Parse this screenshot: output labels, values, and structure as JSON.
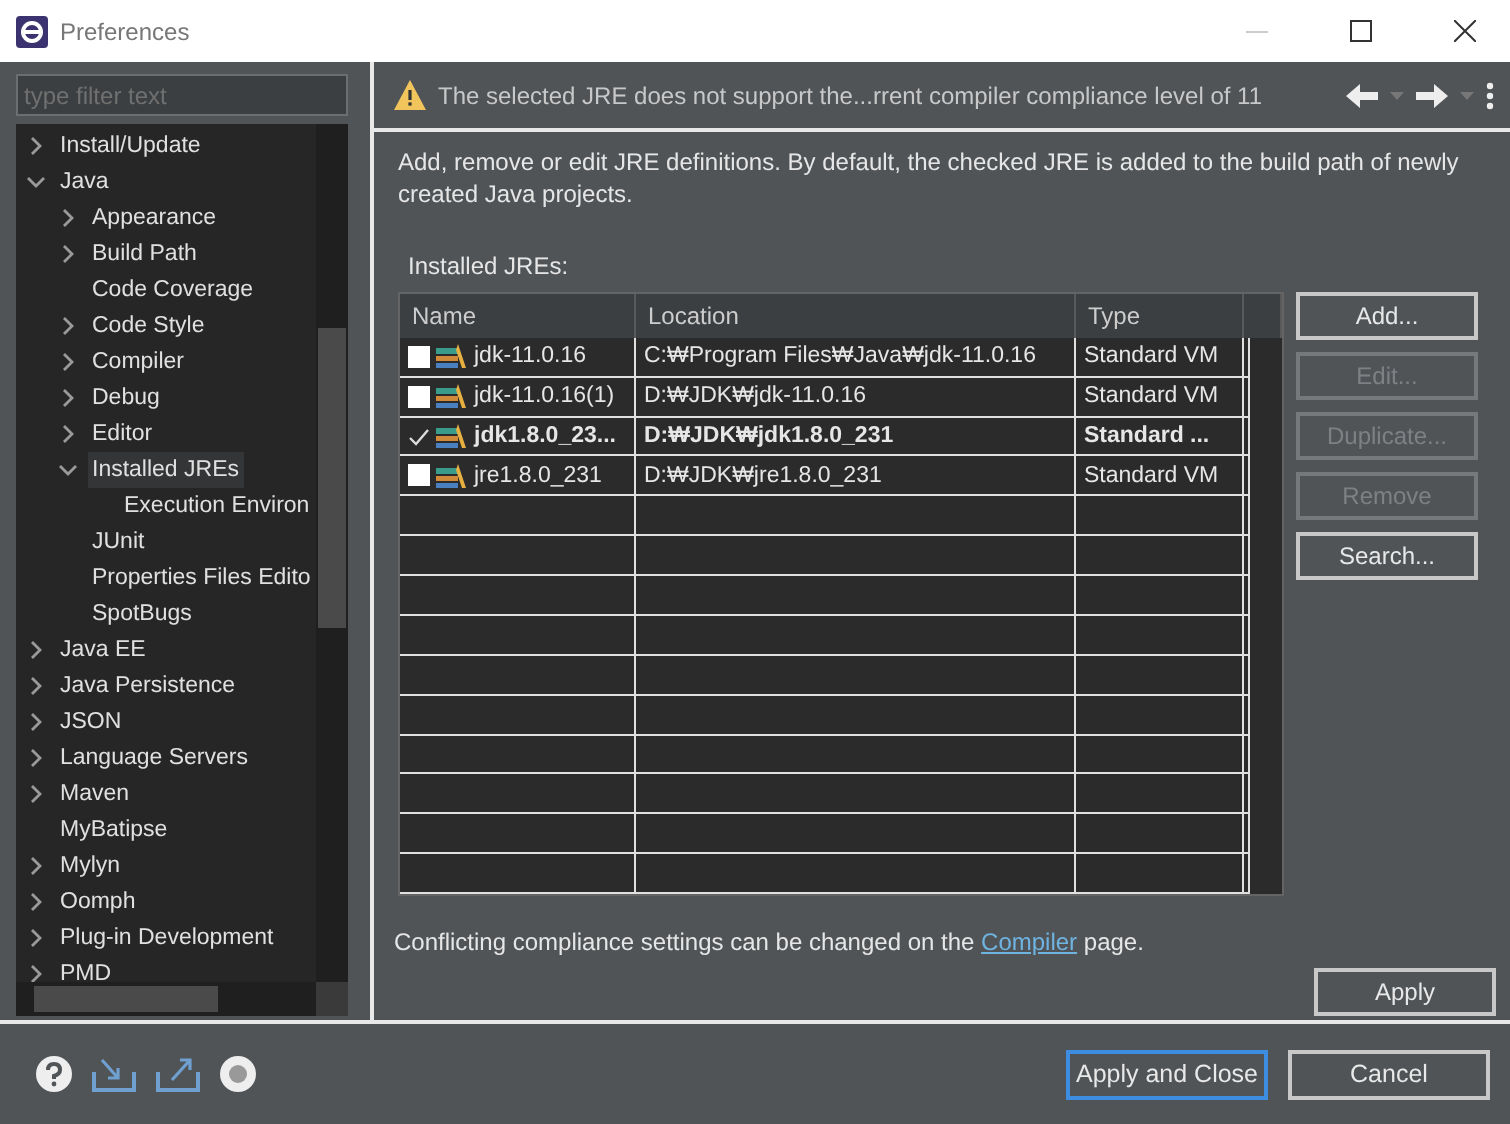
{
  "window": {
    "title": "Preferences"
  },
  "filter": {
    "placeholder": "type filter text"
  },
  "tree": [
    {
      "label": "Install/Update",
      "kind": "branch",
      "expanded": false,
      "selected": false
    },
    {
      "label": "Java",
      "kind": "branch",
      "expanded": true,
      "selected": false,
      "children": [
        {
          "label": "Appearance",
          "kind": "branch",
          "expanded": false,
          "selected": false
        },
        {
          "label": "Build Path",
          "kind": "branch",
          "expanded": false,
          "selected": false
        },
        {
          "label": "Code Coverage",
          "kind": "leaf",
          "selected": false
        },
        {
          "label": "Code Style",
          "kind": "branch",
          "expanded": false,
          "selected": false
        },
        {
          "label": "Compiler",
          "kind": "branch",
          "expanded": false,
          "selected": false
        },
        {
          "label": "Debug",
          "kind": "branch",
          "expanded": false,
          "selected": false
        },
        {
          "label": "Editor",
          "kind": "branch",
          "expanded": false,
          "selected": false
        },
        {
          "label": "Installed JREs",
          "kind": "branch",
          "expanded": true,
          "selected": true,
          "children": [
            {
              "label": "Execution Environ",
              "kind": "leaf",
              "selected": false
            }
          ]
        },
        {
          "label": "JUnit",
          "kind": "leaf",
          "selected": false
        },
        {
          "label": "Properties Files Edito",
          "kind": "leaf",
          "selected": false
        },
        {
          "label": "SpotBugs",
          "kind": "leaf",
          "selected": false
        }
      ]
    },
    {
      "label": "Java EE",
      "kind": "branch",
      "expanded": false,
      "selected": false
    },
    {
      "label": "Java Persistence",
      "kind": "branch",
      "expanded": false,
      "selected": false
    },
    {
      "label": "JSON",
      "kind": "branch",
      "expanded": false,
      "selected": false
    },
    {
      "label": "Language Servers",
      "kind": "branch",
      "expanded": false,
      "selected": false
    },
    {
      "label": "Maven",
      "kind": "branch",
      "expanded": false,
      "selected": false
    },
    {
      "label": "MyBatipse",
      "kind": "leaf",
      "selected": false
    },
    {
      "label": "Mylyn",
      "kind": "branch",
      "expanded": false,
      "selected": false
    },
    {
      "label": "Oomph",
      "kind": "branch",
      "expanded": false,
      "selected": false
    },
    {
      "label": "Plug-in Development",
      "kind": "branch",
      "expanded": false,
      "selected": false
    },
    {
      "label": "PMD",
      "kind": "branch",
      "expanded": false,
      "selected": false
    }
  ],
  "header": {
    "message": "The selected JRE does not support the...rrent compiler compliance level of 11"
  },
  "description": "Add, remove or edit JRE definitions. By default, the checked JRE is added to the build path of newly created Java projects.",
  "table": {
    "label": "Installed JREs:",
    "columns": [
      "Name",
      "Location",
      "Type"
    ],
    "rows": [
      {
        "name": "jdk-11.0.16",
        "location": "C:₩Program Files₩Java₩jdk-11.0.16",
        "type": "Standard VM",
        "checked": false,
        "bold": false
      },
      {
        "name": "jdk-11.0.16(1)",
        "location": "D:₩JDK₩jdk-11.0.16",
        "type": "Standard VM",
        "checked": false,
        "bold": false
      },
      {
        "name": "jdk1.8.0_23...",
        "location": "D:₩JDK₩jdk1.8.0_231",
        "type": "Standard ...",
        "checked": true,
        "bold": true
      },
      {
        "name": "jre1.8.0_231",
        "location": "D:₩JDK₩jre1.8.0_231",
        "type": "Standard VM",
        "checked": false,
        "bold": false
      }
    ]
  },
  "side_buttons": [
    {
      "label": "Add...",
      "disabled": false
    },
    {
      "label": "Edit...",
      "disabled": true
    },
    {
      "label": "Duplicate...",
      "disabled": true
    },
    {
      "label": "Remove",
      "disabled": true
    },
    {
      "label": "Search...",
      "disabled": false
    }
  ],
  "footer_note": {
    "before": "Conflicting compliance settings can be changed on the",
    "link": "Compiler",
    "after": "page."
  },
  "apply": "Apply",
  "buttons": [
    {
      "label": "Apply and Close",
      "default": true
    },
    {
      "label": "Cancel",
      "default": false
    }
  ]
}
